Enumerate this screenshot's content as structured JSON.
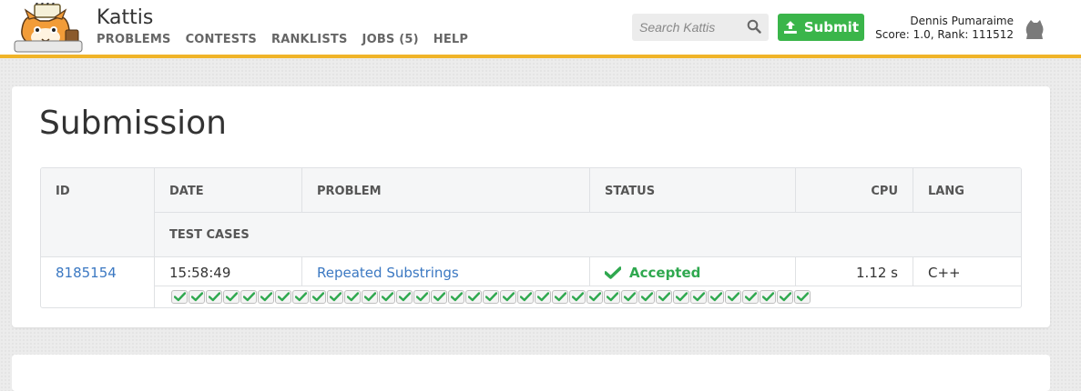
{
  "app": {
    "name": "Kattis"
  },
  "nav": {
    "problems": "PROBLEMS",
    "contests": "CONTESTS",
    "ranklists": "RANKLISTS",
    "jobs": "JOBS (5)",
    "help": "HELP"
  },
  "search": {
    "placeholder": "Search Kattis"
  },
  "submit": {
    "label": "Submit"
  },
  "user": {
    "name": "Dennis Pumaraime",
    "stats": "Score: 1.0, Rank: 111512"
  },
  "page": {
    "title": "Submission"
  },
  "table": {
    "headers": {
      "id": "ID",
      "date": "DATE",
      "problem": "PROBLEM",
      "status": "STATUS",
      "cpu": "CPU",
      "lang": "LANG",
      "test_cases": "TEST CASES"
    },
    "row": {
      "id": "8185154",
      "date": "15:58:49",
      "problem": "Repeated Substrings",
      "status": "Accepted",
      "cpu": "1.12 s",
      "lang": "C++"
    },
    "test_cases": {
      "passed": 37,
      "total": 37
    }
  },
  "colors": {
    "accent": "#f0b429",
    "success": "#3ab54a",
    "link": "#3b78c2"
  }
}
